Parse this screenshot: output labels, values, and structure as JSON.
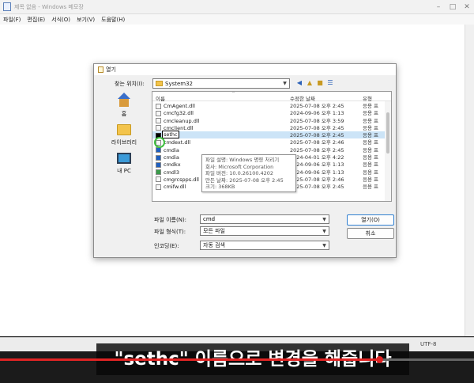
{
  "notepad": {
    "title": "제목 없음 - Windows 메모장",
    "menu": [
      "파일(F)",
      "편집(E)",
      "서식(O)",
      "보기(V)",
      "도움말(H)"
    ],
    "status_encoding": "UTF-8"
  },
  "dialog": {
    "title": "열기",
    "lookin_label": "찾는 위치(I):",
    "lookin_value": "System32",
    "places": [
      {
        "label": "홈",
        "icon": "home-icon"
      },
      {
        "label": "라이브러리",
        "icon": "library-icon"
      },
      {
        "label": "내 PC",
        "icon": "pc-icon"
      }
    ],
    "columns": {
      "name": "이름",
      "date": "수정한 날짜",
      "type": "유형"
    },
    "files": [
      {
        "name": "CmAgent.dll",
        "date": "2025-07-08 오후 2:45",
        "type": "응용 프"
      },
      {
        "name": "cmcfg32.dll",
        "date": "2024-09-06 오후 1:13",
        "type": "응용 프"
      },
      {
        "name": "cmcleanup.dll",
        "date": "2025-07-08 오후 3:59",
        "type": "응용 프"
      },
      {
        "name": "cmclient.dll",
        "date": "2025-07-08 오후 2:45",
        "type": "응용 프"
      },
      {
        "name": "sethc",
        "date": "2025-07-08 오후 2:45",
        "type": "응용 프"
      },
      {
        "name": "cmdext.dll",
        "date": "2025-07-08 오후 2:46",
        "type": "응용 프"
      },
      {
        "name": "cmdia",
        "date": "2025-07-08 오후 2:45",
        "type": "응용 프"
      },
      {
        "name": "cmdia",
        "date": "2024-04-01 오후 4:22",
        "type": "응용 프"
      },
      {
        "name": "cmdkx",
        "date": "2024-09-06 오후 1:13",
        "type": "응용 프"
      },
      {
        "name": "cmdl3",
        "date": "2024-09-06 오후 1:13",
        "type": "응용 프"
      },
      {
        "name": "cmgrcspps.dll",
        "date": "2025-07-08 오후 2:46",
        "type": "응용 프"
      },
      {
        "name": "cmifw.dll",
        "date": "2025-07-08 오후 2:45",
        "type": "응용 프"
      }
    ],
    "rename_value": "sethc",
    "tooltip": [
      "파일 설명: Windows 명령 처리기",
      "회사: Microsoft Corporation",
      "파일 버전: 10.0.26100.4202",
      "만든 날짜: 2025-07-08 오후 2:45",
      "크기: 368KB"
    ],
    "filename_label": "파일 이름(N):",
    "filename_value": "cmd",
    "filetype_label": "파일 형식(T):",
    "filetype_value": "모든 파일",
    "encoding_label": "인코딩(E):",
    "encoding_value": "자동 검색",
    "open_button": "열기(O)",
    "cancel_button": "취소"
  },
  "video": {
    "caption": "\"sethc\" 이름으로 변경을 해줍니다",
    "progress_fraction": 0.8
  }
}
